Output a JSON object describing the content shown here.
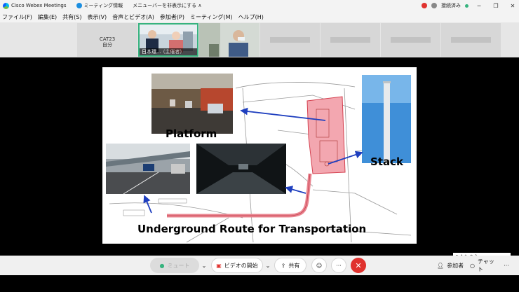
{
  "titlebar": {
    "app_title": "Cisco Webex Meetings",
    "meeting_info": "ミーティング情報",
    "hide_menu": "メニューバーを非表示にする ∧",
    "status": "接続済み"
  },
  "menu": {
    "items": [
      "ファイル(F)",
      "編集(E)",
      "共有(S)",
      "表示(V)",
      "音声とビデオ(A)",
      "参加者(P)",
      "ミーティング(M)",
      "ヘルプ(H)"
    ]
  },
  "participants": {
    "self_line1": "CAT23",
    "self_line2": "自分",
    "tile1_name": "日本環...",
    "tile1_role": "(主催者)"
  },
  "slide": {
    "label_platform": "Platform",
    "label_stack": "Stack",
    "label_route": "Underground Route for Transportation"
  },
  "controls": {
    "mute": "ミュート",
    "video": "ビデオの開始",
    "share": "共有",
    "participants": "参加者",
    "chat": "チャット",
    "more": "···"
  },
  "colors": {
    "end_red": "#e0322e",
    "active_green": "#36b37e",
    "arrow_blue": "#1f3fbf",
    "site_pink": "#f3a7b0"
  }
}
